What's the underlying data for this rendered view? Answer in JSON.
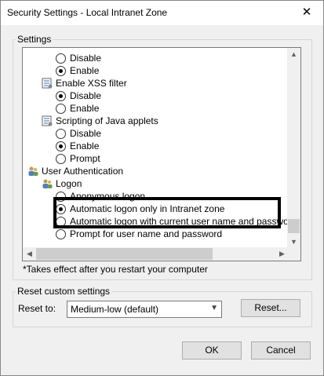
{
  "window": {
    "title": "Security Settings - Local Intranet Zone",
    "close_glyph": "✕"
  },
  "settings_group": {
    "label": "Settings",
    "items": [
      {
        "kind": "option",
        "label": "Disable",
        "checked": false
      },
      {
        "kind": "option",
        "label": "Enable",
        "checked": true
      },
      {
        "kind": "setting",
        "label": "Enable XSS filter",
        "icon": "setting-icon"
      },
      {
        "kind": "option",
        "label": "Disable",
        "checked": true
      },
      {
        "kind": "option",
        "label": "Enable",
        "checked": false
      },
      {
        "kind": "setting",
        "label": "Scripting of Java applets",
        "icon": "setting-icon"
      },
      {
        "kind": "option",
        "label": "Disable",
        "checked": false
      },
      {
        "kind": "option",
        "label": "Enable",
        "checked": true
      },
      {
        "kind": "option",
        "label": "Prompt",
        "checked": false
      },
      {
        "kind": "category",
        "label": "User Authentication",
        "icon": "users-icon"
      },
      {
        "kind": "subcategory",
        "label": "Logon",
        "icon": "users-icon"
      },
      {
        "kind": "option",
        "label": "Anonymous logon",
        "checked": false
      },
      {
        "kind": "option",
        "label": "Automatic logon only in Intranet zone",
        "checked": true
      },
      {
        "kind": "option",
        "label": "Automatic logon with current user name and password",
        "checked": false
      },
      {
        "kind": "option",
        "label": "Prompt for user name and password",
        "checked": false
      }
    ],
    "note": "*Takes effect after you restart your computer"
  },
  "reset_group": {
    "label": "Reset custom settings",
    "reset_to_label": "Reset to:",
    "selected": "Medium-low (default)",
    "reset_button": "Reset..."
  },
  "footer": {
    "ok": "OK",
    "cancel": "Cancel"
  }
}
